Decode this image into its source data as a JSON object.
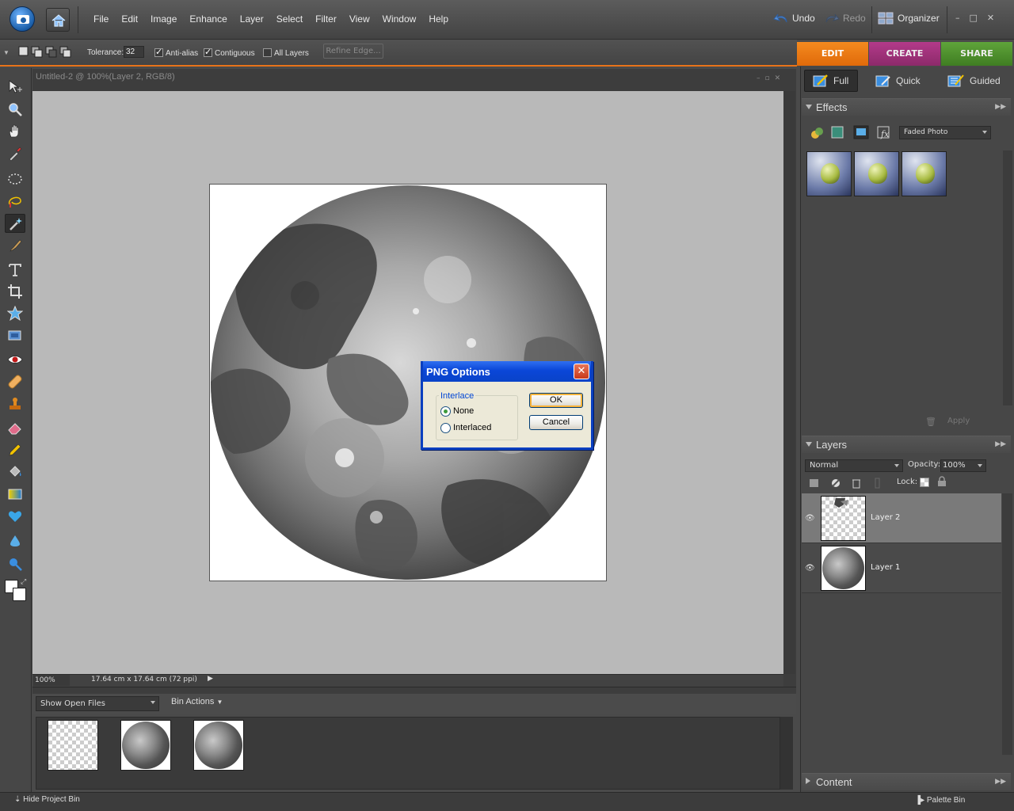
{
  "menubar": {
    "menus": [
      "File",
      "Edit",
      "Image",
      "Enhance",
      "Layer",
      "Select",
      "Filter",
      "View",
      "Window",
      "Help"
    ],
    "undo": "Undo",
    "redo": "Redo",
    "organizer": "Organizer",
    "window_controls": [
      "–",
      "□",
      "✕"
    ]
  },
  "options": {
    "tolerance_label": "Tolerance:",
    "tolerance_value": "32",
    "antialias": {
      "label": "Anti-alias",
      "checked": true
    },
    "contiguous": {
      "label": "Contiguous",
      "checked": true
    },
    "all_layers": {
      "label": "All Layers",
      "checked": false
    },
    "refine_edge": "Refine Edge..."
  },
  "mode_tabs": {
    "edit": "EDIT",
    "create": "CREATE",
    "share": "SHARE"
  },
  "sub_tabs": {
    "full": "Full",
    "quick": "Quick",
    "guided": "Guided"
  },
  "document": {
    "title": "Untitled-2 @ 100%(Layer 2, RGB/8)",
    "zoom": "100%",
    "dimensions": "17.64 cm x 17.64 cm (72 ppi)"
  },
  "dialog": {
    "title": "PNG Options",
    "group_label": "Interlace",
    "options": [
      "None",
      "Interlaced"
    ],
    "selected": "None",
    "ok": "OK",
    "cancel": "Cancel"
  },
  "bin": {
    "show_open_files": "Show Open Files",
    "bin_actions": "Bin Actions",
    "hide_project_bin": "Hide Project Bin",
    "palette_bin": "Palette Bin"
  },
  "effects": {
    "header": "Effects",
    "filter": "Faded Photo",
    "apply": "Apply"
  },
  "layers": {
    "header": "Layers",
    "blend_mode": "Normal",
    "opacity_label": "Opacity:",
    "opacity": "100%",
    "lock_label": "Lock:",
    "items": [
      {
        "name": "Layer 2",
        "selected": true
      },
      {
        "name": "Layer 1",
        "selected": false
      }
    ]
  },
  "content": {
    "header": "Content"
  },
  "colors": {
    "accent": "#e8731a",
    "dialog_title": "#0a46d8"
  }
}
